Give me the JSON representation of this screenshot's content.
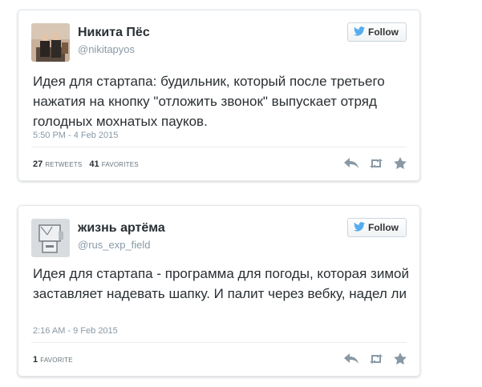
{
  "colors": {
    "twitter_blue": "#55acee",
    "text": "#292f33",
    "muted": "#8899a6",
    "icon": "#8899a6"
  },
  "tweets": [
    {
      "name": "Никита Пёс",
      "handle": "@nikitapyos",
      "follow_label": "Follow",
      "text": "Идея для стартапа: будильник, который после третьего нажатия на кнопку \"отложить звонок\" выпускает отряд голодных мохнатых пауков.",
      "timestamp": "5:50 PM - 4 Feb 2015",
      "retweets_count": "27",
      "retweets_label": "RETWEETS",
      "favorites_count": "41",
      "favorites_label": "FAVORITES"
    },
    {
      "name": "жизнь артёма",
      "handle": "@rus_exp_field",
      "follow_label": "Follow",
      "text": "Идея для стартапа - программа для погоды, которая зимой заставляет надевать шапку. И палит через вебку, надел ли",
      "timestamp": "2:16 AM - 9 Feb 2015",
      "favorites_count": "1",
      "favorites_label": "FAVORITE"
    }
  ]
}
